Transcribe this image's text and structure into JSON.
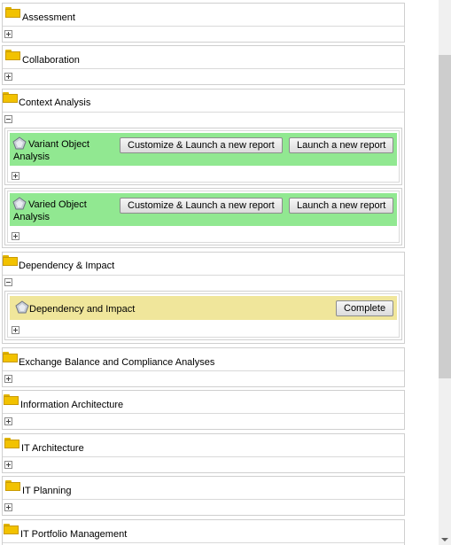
{
  "categories": {
    "assessment": "Assessment",
    "collaboration": "Collaboration",
    "context_analysis": "Context Analysis",
    "dependency_impact": "Dependency & Impact",
    "exchange_balance": "Exchange Balance and Compliance Analyses",
    "information_architecture": "Information Architecture",
    "it_architecture": "IT Architecture",
    "it_planning": "IT Planning",
    "it_portfolio": "IT Portfolio Management"
  },
  "reports": {
    "variant": {
      "name": "Variant Object Analysis",
      "customize_label": "Customize & Launch a new report",
      "launch_label": "Launch a new report"
    },
    "varied": {
      "name": "Varied Object Analysis",
      "customize_label": "Customize & Launch a new report",
      "launch_label": "Launch a new report"
    },
    "dependency": {
      "name": "Dependency and Impact",
      "complete_label": "Complete"
    }
  },
  "colors": {
    "green_report_bg": "#91e891",
    "yellow_report_bg": "#f0e69b",
    "folder": "#f2c200"
  },
  "icons": {
    "folder": "folder-icon",
    "report": "report-icon",
    "expand": "expand-icon",
    "collapse": "collapse-icon"
  }
}
